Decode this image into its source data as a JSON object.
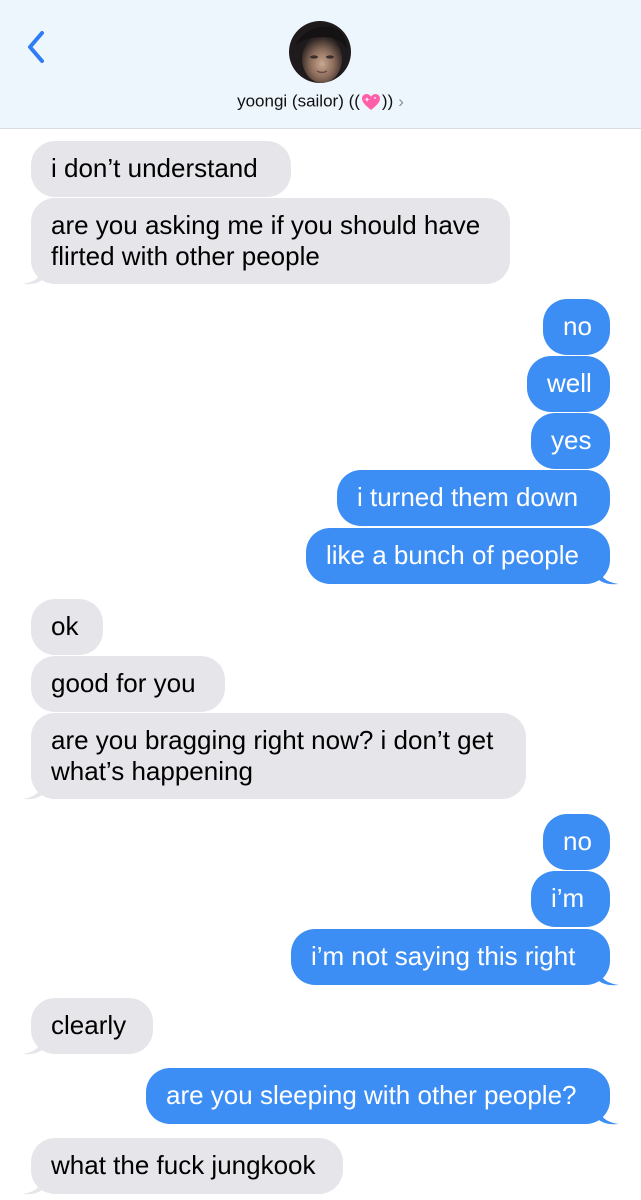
{
  "header": {
    "contact_name": "yoongi (sailor) ((",
    "contact_name_end": "))",
    "heart_icon": "sparkling-heart-icon",
    "chevron": "›",
    "back_icon": "chevron-left-icon"
  },
  "colors": {
    "incoming_bubble": "#e5e5ea",
    "outgoing_bubble": "#3d8ef4",
    "header_bg": "#eef6fd",
    "accent": "#2f7df6"
  },
  "messages": [
    {
      "side": "in",
      "text": "i don’t understand"
    },
    {
      "side": "in",
      "text": "are you asking me if you should have\nflirted with other people"
    },
    {
      "side": "out",
      "text": "no"
    },
    {
      "side": "out",
      "text": "well"
    },
    {
      "side": "out",
      "text": "yes"
    },
    {
      "side": "out",
      "text": "i turned them down"
    },
    {
      "side": "out",
      "text": "like a bunch of people"
    },
    {
      "side": "in",
      "text": "ok"
    },
    {
      "side": "in",
      "text": "good for you"
    },
    {
      "side": "in",
      "text": "are you bragging right now? i don’t get\nwhat’s happening"
    },
    {
      "side": "out",
      "text": "no"
    },
    {
      "side": "out",
      "text": "i’m"
    },
    {
      "side": "out",
      "text": "i’m not saying this right"
    },
    {
      "side": "in",
      "text": "clearly"
    },
    {
      "side": "out",
      "text": "are you sleeping with other people?"
    },
    {
      "side": "in",
      "text": "what the fuck jungkook"
    }
  ]
}
